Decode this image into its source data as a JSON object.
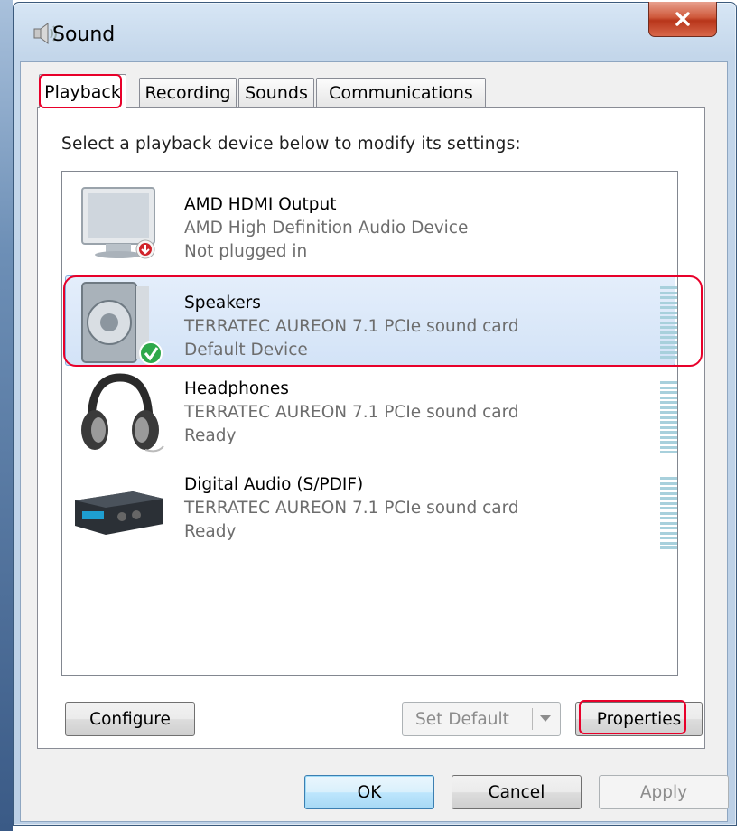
{
  "window": {
    "title": "Sound"
  },
  "tabs": [
    {
      "label": "Playback",
      "active": true
    },
    {
      "label": "Recording",
      "active": false
    },
    {
      "label": "Sounds",
      "active": false
    },
    {
      "label": "Communications",
      "active": false
    }
  ],
  "instruction": "Select a playback device below to modify its settings:",
  "devices": [
    {
      "name": "AMD HDMI Output",
      "driver": "AMD High Definition Audio Device",
      "status": "Not plugged in",
      "icon": "monitor-icon",
      "badge": "unplugged-badge-icon",
      "selected": false,
      "meter_visible": false
    },
    {
      "name": "Speakers",
      "driver": "TERRATEC AUREON 7.1 PCIe sound card",
      "status": "Default Device",
      "icon": "speaker-icon",
      "badge": "default-check-icon",
      "selected": true,
      "meter_visible": true
    },
    {
      "name": "Headphones",
      "driver": "TERRATEC AUREON 7.1 PCIe sound card",
      "status": "Ready",
      "icon": "headphones-icon",
      "selected": false,
      "meter_visible": true
    },
    {
      "name": "Digital Audio (S/PDIF)",
      "driver": "TERRATEC AUREON 7.1 PCIe sound card",
      "status": "Ready",
      "icon": "receiver-icon",
      "selected": false,
      "meter_visible": true
    }
  ],
  "buttons": {
    "configure": "Configure",
    "set_default": "Set Default",
    "properties": "Properties",
    "ok": "OK",
    "cancel": "Cancel",
    "apply": "Apply"
  },
  "colors": {
    "highlight": "#e8002a",
    "selection": "#d3e3f7",
    "close_button": "#c94a2e"
  }
}
